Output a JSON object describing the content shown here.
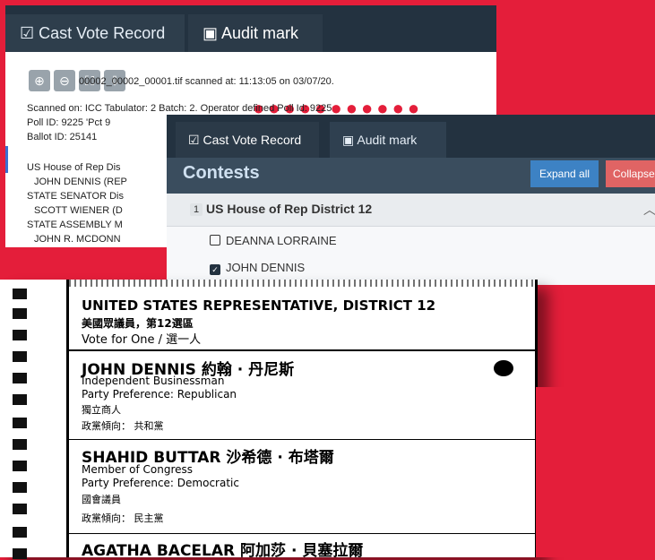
{
  "window1": {
    "tabs": [
      {
        "label": "Cast Vote Record",
        "icon": "check-square-icon"
      },
      {
        "label": "Audit mark",
        "icon": "image-icon"
      }
    ],
    "file_line": "00002_00002_00001.tif scanned at: 11:13:05 on 03/07/20.",
    "scanned_on": "Scanned on: ICC  Tabulator:  2   Batch:  2.   Operator defined Poll Id: 9225",
    "poll_id": "Poll ID:  9225  'Pct 9",
    "ballot_id": "Ballot ID:  25141",
    "lines": [
      "US House of Rep Dis",
      "JOHN DENNIS (REP",
      "STATE SENATOR Dis",
      "SCOTT WIENER (D",
      "STATE ASSEMBLY M",
      "JOHN R. MCDONN"
    ]
  },
  "window2": {
    "tabs": [
      {
        "label": "Cast Vote Record",
        "icon": "check-square-icon"
      },
      {
        "label": "Audit mark",
        "icon": "image-icon"
      }
    ],
    "contests_title": "Contests",
    "expand_all": "Expand all",
    "collapse_all": "Collapse all",
    "contest": {
      "number": "1",
      "name": "US House of Rep District 12"
    },
    "candidates": [
      {
        "name": "DEANNA LORRAINE",
        "checked": false
      },
      {
        "name": "JOHN DENNIS",
        "checked": true
      }
    ]
  },
  "ballot": {
    "title": "UNITED STATES REPRESENTATIVE, DISTRICT 12",
    "title_cn": "美國眾議員，第12選區",
    "vote_for": "Vote for One / 選一人",
    "candidates": [
      {
        "name": "JOHN DENNIS 約翰 · 丹尼斯",
        "occupation": "Independent Businessman",
        "party": "Party Preference: Republican",
        "occupation_cn": "獨立商人",
        "party_cn": "政黨傾向： 共和黨",
        "marked": true
      },
      {
        "name": "SHAHID BUTTAR 沙希德 · 布塔爾",
        "occupation": "Member of Congress",
        "party": "Party Preference: Democratic",
        "occupation_cn": "國會議員",
        "party_cn": "政黨傾向： 民主黨",
        "marked": false
      },
      {
        "name": "AGATHA BACELAR 阿加莎 · 貝塞拉爾"
      }
    ]
  },
  "colors": {
    "background": "#e41e3a",
    "navbar": "#233240",
    "expand": "#3d82c4",
    "collapse": "#e06464"
  }
}
